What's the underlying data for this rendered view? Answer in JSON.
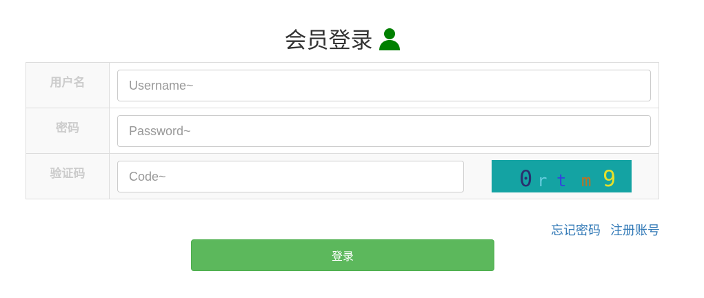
{
  "header": {
    "title": "会员登录",
    "icon": "user-icon",
    "icon_color": "#008000"
  },
  "form": {
    "username": {
      "label": "用户名",
      "placeholder": "Username~",
      "value": ""
    },
    "password": {
      "label": "密码",
      "placeholder": "Password~",
      "value": ""
    },
    "code": {
      "label": "验证码",
      "placeholder": "Code~",
      "value": ""
    },
    "captcha": {
      "background": "#14a3a3",
      "characters": [
        {
          "char": "0",
          "color": "#2a2f6e"
        },
        {
          "char": "r",
          "color": "#66ccdd"
        },
        {
          "char": "t",
          "color": "#3344dd"
        },
        {
          "char": "m",
          "color": "#c0701f"
        },
        {
          "char": "9",
          "color": "#e6e02a"
        }
      ]
    }
  },
  "links": {
    "forgot_password": "忘记密码",
    "register": "注册账号",
    "color": "#337ab7"
  },
  "actions": {
    "login_label": "登录",
    "login_color": "#5cb85c"
  }
}
